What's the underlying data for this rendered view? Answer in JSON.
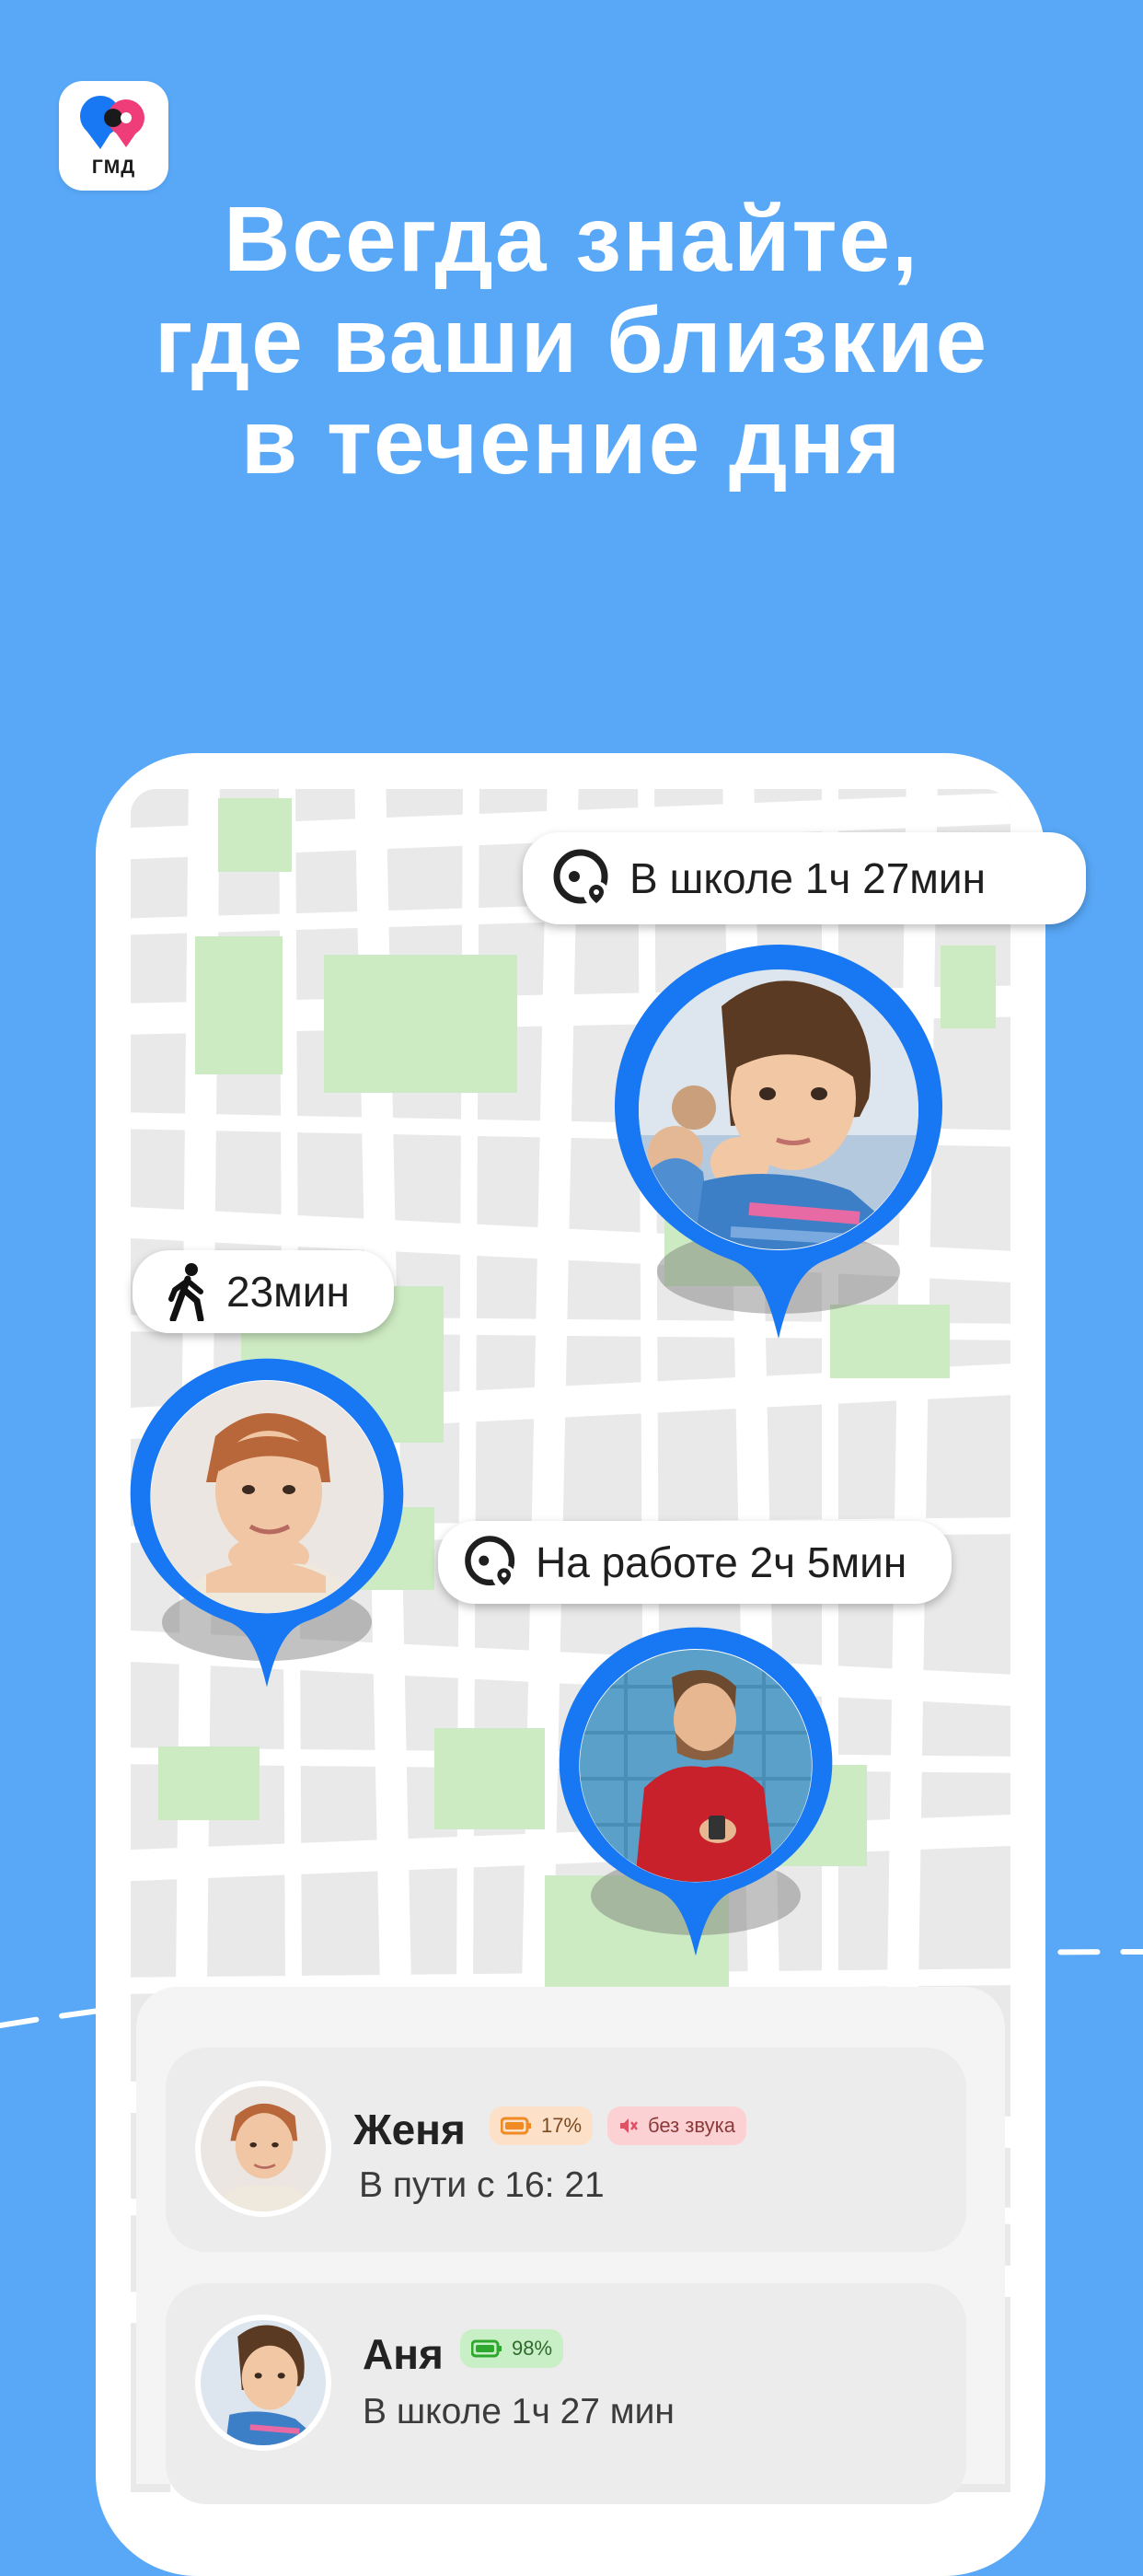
{
  "app": {
    "icon_label": "ГМД",
    "headline_lines": [
      "Всегда знайте,",
      "где ваши близкие",
      "в течение дня"
    ]
  },
  "colors": {
    "background": "#58a8f7",
    "pin_blue": "#1877f2",
    "map_green": "#cdebc2",
    "battery_low": "#f08a24",
    "mute": "#e05263",
    "battery_ok": "#2fa82f"
  },
  "map": {
    "pills": [
      {
        "icon": "location-clock-icon",
        "text": "В школе 1ч 27мин"
      },
      {
        "icon": "walking-person-icon",
        "text": "23мин"
      },
      {
        "icon": "location-clock-icon",
        "text": "На работе 2ч 5мин"
      }
    ],
    "pins": [
      {
        "name": "girl",
        "photo": "girl-photo"
      },
      {
        "name": "boy",
        "photo": "boy-photo"
      },
      {
        "name": "man",
        "photo": "man-photo"
      }
    ]
  },
  "contacts": [
    {
      "name": "Женя",
      "status": "В пути с 16: 21",
      "battery": "17%",
      "mute_label": "без звука"
    },
    {
      "name": "Аня",
      "status": "В школе 1ч 27 мин",
      "battery": "98%"
    }
  ]
}
